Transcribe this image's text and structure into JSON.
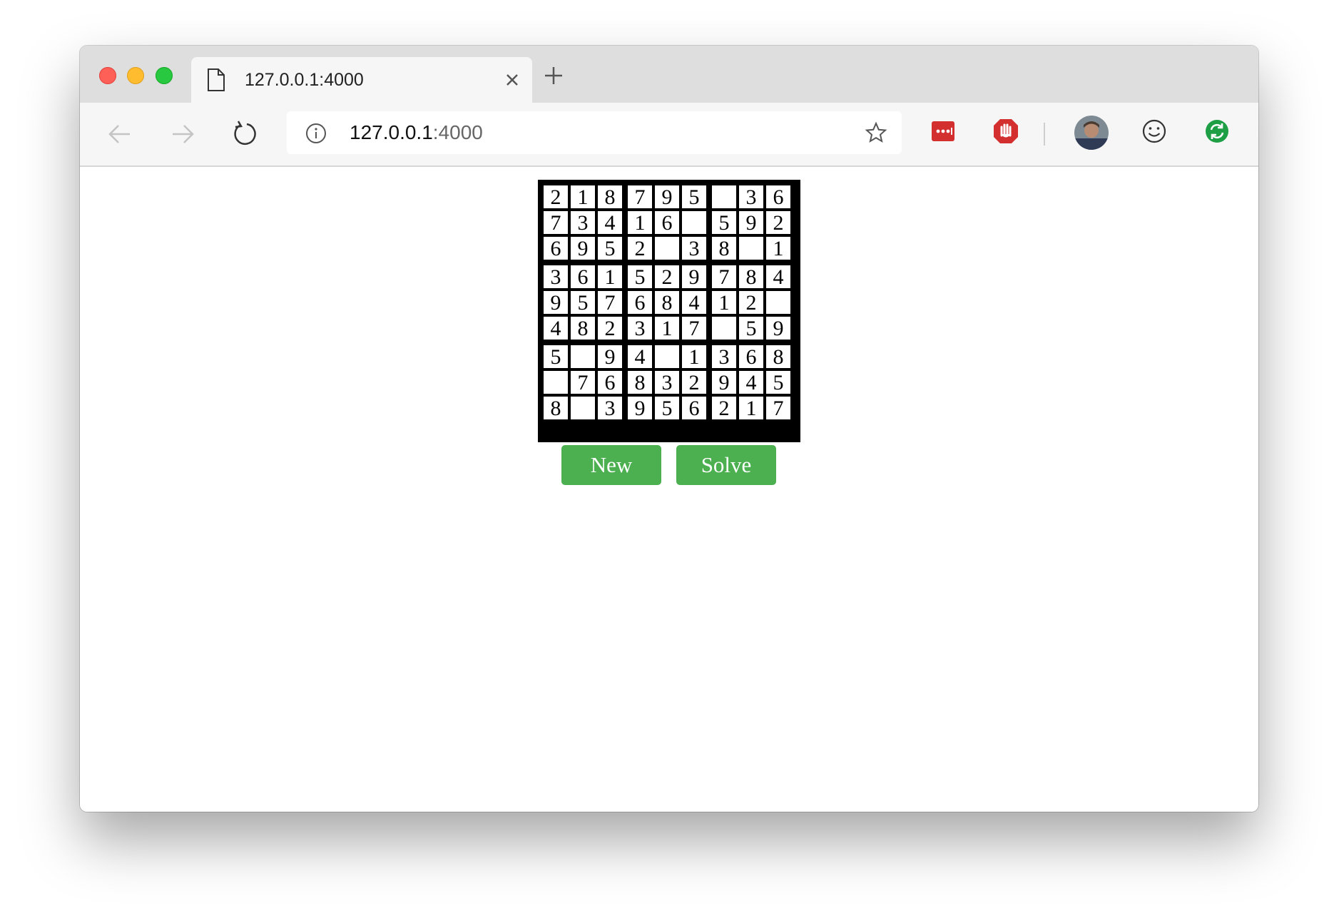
{
  "browser": {
    "tab": {
      "title": "127.0.0.1:4000"
    },
    "address_bar": {
      "host": "127.0.0.1",
      "port": ":4000"
    }
  },
  "sudoku": {
    "rows": [
      [
        "2",
        "1",
        "8",
        "7",
        "9",
        "5",
        "",
        "3",
        "6"
      ],
      [
        "7",
        "3",
        "4",
        "1",
        "6",
        "",
        "5",
        "9",
        "2"
      ],
      [
        "6",
        "9",
        "5",
        "2",
        "",
        "3",
        "8",
        "",
        "1"
      ],
      [
        "3",
        "6",
        "1",
        "5",
        "2",
        "9",
        "7",
        "8",
        "4"
      ],
      [
        "9",
        "5",
        "7",
        "6",
        "8",
        "4",
        "1",
        "2",
        ""
      ],
      [
        "4",
        "8",
        "2",
        "3",
        "1",
        "7",
        "",
        "5",
        "9"
      ],
      [
        "5",
        "",
        "9",
        "4",
        "",
        "1",
        "3",
        "6",
        "8"
      ],
      [
        "",
        "7",
        "6",
        "8",
        "3",
        "2",
        "9",
        "4",
        "5"
      ],
      [
        "8",
        "",
        "3",
        "9",
        "5",
        "6",
        "2",
        "1",
        "7"
      ]
    ]
  },
  "buttons": {
    "new_label": "New",
    "solve_label": "Solve"
  },
  "colors": {
    "button_bg": "#4caf50",
    "extension_red": "#d32f2f",
    "sync_green": "#1e9e45"
  }
}
